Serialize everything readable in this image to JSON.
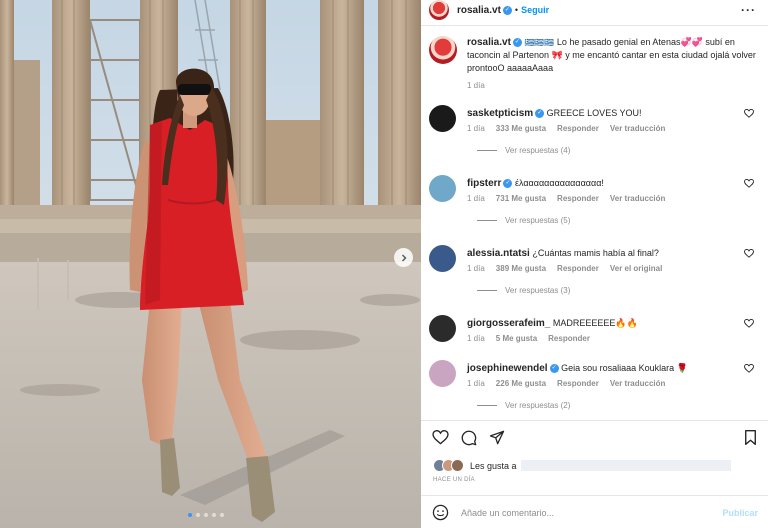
{
  "post": {
    "author": "rosalia.vt",
    "follow_label": "Seguir",
    "caption_emoji": "🇬🇷🇬🇷🇬🇷",
    "caption_text": "Lo he pasado genial en Atenas💞💞 subí en taconcin al Partenon 🎀 y me encantó cantar en esta ciudad ojalá volver prontooO aaaaaAaaa",
    "caption_time": "1 día",
    "photo_alt": "photo",
    "carousel_dots": 5,
    "active_dot": 0
  },
  "comments": [
    {
      "user": "sasketpticism",
      "verified": true,
      "text": "GREECE LOVES YOU!",
      "time": "1 día",
      "likes": "333 Me gusta",
      "reply": "Responder",
      "translate": "Ver traducción",
      "replies": "Ver respuestas (4)",
      "avatar_color": "#1a1a1a"
    },
    {
      "user": "fipsterr",
      "verified": true,
      "text": "έλααααααααααααααα!",
      "time": "1 día",
      "likes": "731 Me gusta",
      "reply": "Responder",
      "translate": "Ver traducción",
      "replies": "Ver respuestas (5)",
      "avatar_color": "#6fa8c8"
    },
    {
      "user": "alessia.ntatsi",
      "verified": false,
      "text": "¿Cuántas mamis había al final?",
      "time": "1 día",
      "likes": "389 Me gusta",
      "reply": "Responder",
      "translate": "Ver el original",
      "replies": "Ver respuestas (3)",
      "avatar_color": "#3a5a8c"
    },
    {
      "user": "giorgosserafeim_",
      "verified": false,
      "text": "MADREEEEEE🔥🔥",
      "time": "1 día",
      "likes": "5 Me gusta",
      "reply": "Responder",
      "translate": "",
      "replies": "",
      "avatar_color": "#2b2b2b"
    },
    {
      "user": "josephinewendel",
      "verified": true,
      "text": "Geia sou rosaliaaa Kouklara 🌹",
      "time": "1 día",
      "likes": "226 Me gusta",
      "reply": "Responder",
      "translate": "Ver traducción",
      "replies": "Ver respuestas (2)",
      "avatar_color": "#c9a5c2"
    }
  ],
  "actions": {
    "likes_prefix": "Les gusta a",
    "date_label": "HACE UN DÍA",
    "comment_placeholder": "Añade un comentario...",
    "post_label": "Publicar"
  },
  "icons": {
    "more": "more-options-icon",
    "heart": "heart-icon",
    "comment": "comment-icon",
    "share": "share-icon",
    "save": "bookmark-icon",
    "emoji": "emoji-icon",
    "next": "chevron-right-icon"
  },
  "colors": {
    "accent": "#0095f6",
    "verified": "#3897f0",
    "dress": "#d81f26"
  }
}
